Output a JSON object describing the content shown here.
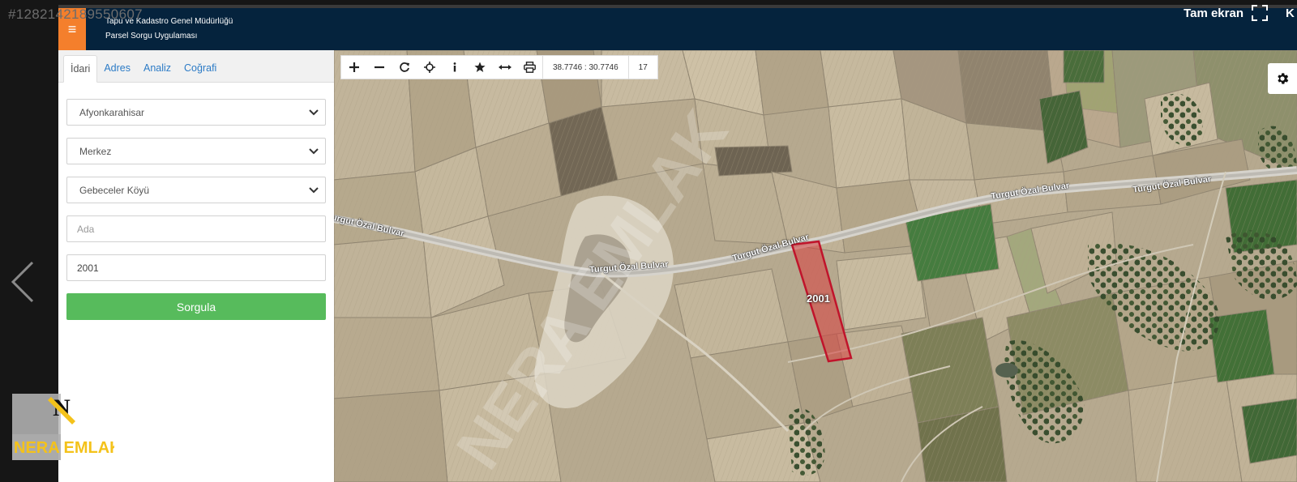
{
  "viewer": {
    "listing_id": "#1282142189550607",
    "fullscreen_label": "Tam ekran",
    "edge_letter": "K"
  },
  "header": {
    "org_title": "Tapu ve Kadastro Genel Müdürlüğü",
    "app_title": "Parsel Sorgu Uygulaması"
  },
  "tabs": [
    {
      "label": "İdari",
      "active": true
    },
    {
      "label": "Adres",
      "active": false
    },
    {
      "label": "Analiz",
      "active": false
    },
    {
      "label": "Coğrafi",
      "active": false
    }
  ],
  "form": {
    "province": "Afyonkarahisar",
    "district": "Merkez",
    "neighborhood": "Gebeceler Köyü",
    "block_placeholder": "Ada",
    "block_value": "",
    "parcel_value": "2001",
    "submit_label": "Sorgula"
  },
  "map": {
    "coordinates": "38.7746 : 30.7746",
    "zoom_level": "17",
    "road_name": "Turgut Özal Bulvar",
    "parcel_number": "2001",
    "watermark_text": "NERA EMLAK",
    "parcel_outline_color": "#c0142b",
    "parcel_fill_color": "#d9403f"
  },
  "logo": {
    "text": "NERA EMLAK",
    "accent_color": "#f4c21a"
  },
  "icons": {
    "menu": "hamburger-icon",
    "settings": "gear-icon",
    "toolbar": [
      "zoom-in-icon",
      "zoom-out-icon",
      "refresh-icon",
      "locate-icon",
      "info-icon",
      "favorite-icon",
      "measure-icon",
      "print-icon"
    ]
  }
}
